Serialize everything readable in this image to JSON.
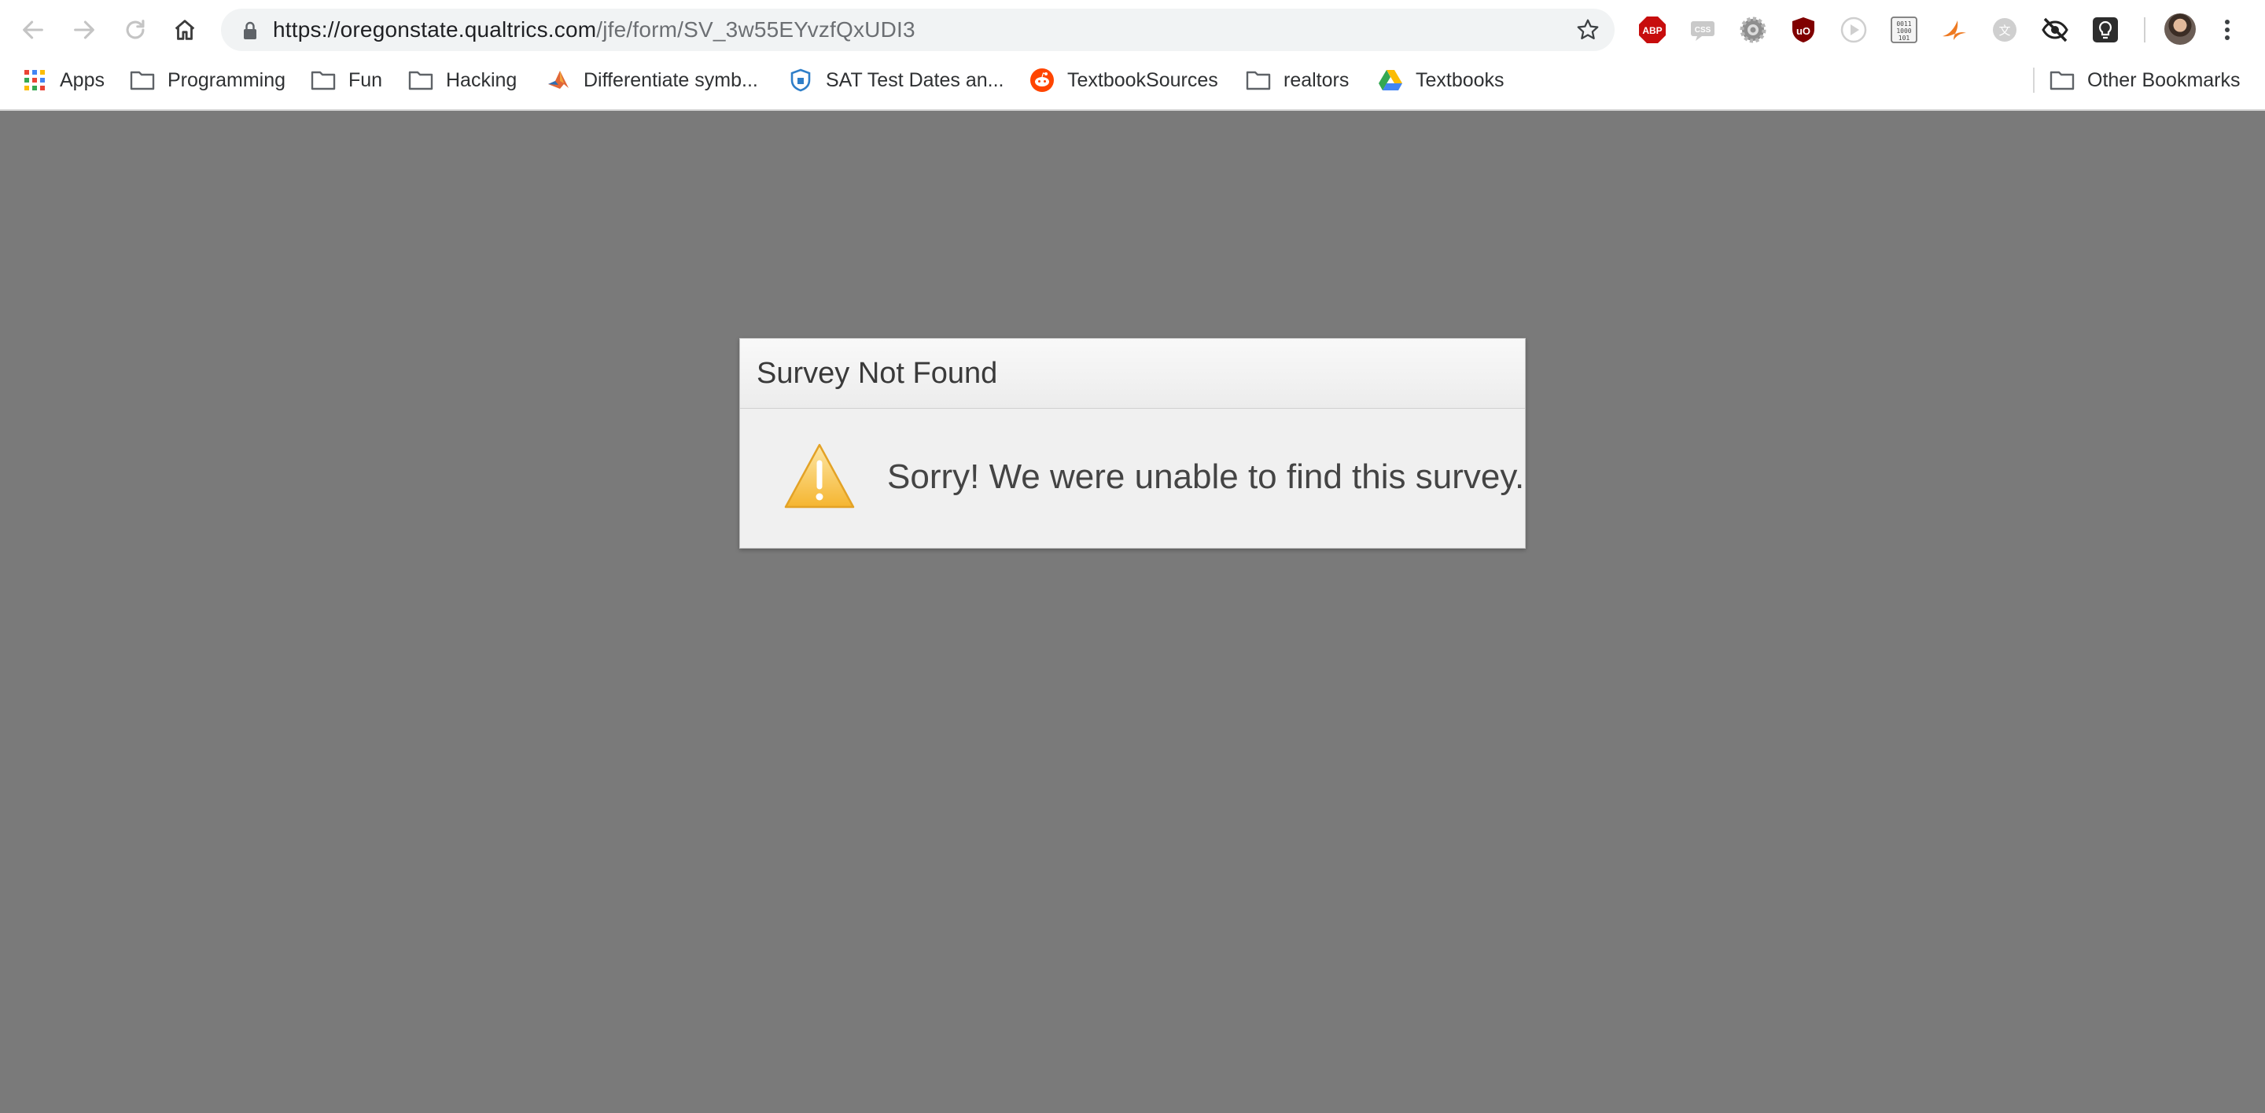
{
  "browser": {
    "url_host": "https://oregonstate.qualtrics.com",
    "url_path": "/jfe/form/SV_3w55EYvzfQxUDI3",
    "nav": {
      "back": "back-arrow-icon",
      "forward": "forward-arrow-icon",
      "reload": "reload-icon",
      "home": "home-icon"
    },
    "extensions": [
      {
        "name": "adblock-plus-icon",
        "text": "ABP"
      },
      {
        "name": "css-extension-icon",
        "text": "CSS"
      },
      {
        "name": "gear-extension-icon"
      },
      {
        "name": "ublock-origin-icon",
        "text": "uO"
      },
      {
        "name": "play-extension-icon"
      },
      {
        "name": "binary-extension-icon",
        "text": "0011 1000 101"
      },
      {
        "name": "swift-bird-extension-icon"
      },
      {
        "name": "translate-extension-icon",
        "text": "文"
      },
      {
        "name": "eye-slash-extension-icon"
      },
      {
        "name": "lightbulb-extension-icon"
      }
    ]
  },
  "bookmarks": [
    {
      "label": "Apps",
      "icon": "apps-grid-icon"
    },
    {
      "label": "Programming",
      "icon": "folder-icon"
    },
    {
      "label": "Fun",
      "icon": "folder-icon"
    },
    {
      "label": "Hacking",
      "icon": "folder-icon"
    },
    {
      "label": "Differentiate symb...",
      "icon": "matlab-icon"
    },
    {
      "label": "SAT Test Dates an...",
      "icon": "college-board-icon"
    },
    {
      "label": "TextbookSources",
      "icon": "reddit-icon"
    },
    {
      "label": "realtors",
      "icon": "folder-icon"
    },
    {
      "label": "Textbooks",
      "icon": "google-drive-icon"
    }
  ],
  "other_bookmarks": {
    "label": "Other Bookmarks",
    "icon": "folder-icon"
  },
  "dialog": {
    "title": "Survey Not Found",
    "message": "Sorry! We were unable to find this survey.",
    "icon": "warning-icon",
    "warning_color": "#f5b530"
  },
  "colors": {
    "page_background": "#7a7a7a",
    "dialog_background": "#f0f0f0",
    "reddit": "#ff4500",
    "adblock": "#c70d0d",
    "ublock": "#800000"
  }
}
